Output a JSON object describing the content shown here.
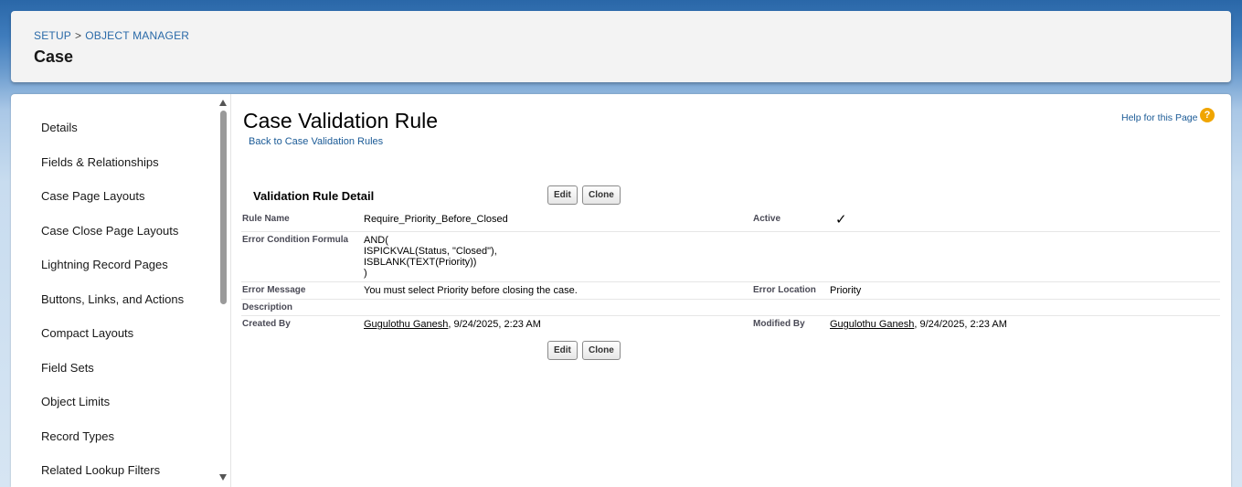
{
  "header": {
    "breadcrumb": [
      "SETUP",
      "OBJECT MANAGER"
    ],
    "breadcrumb_sep": ">",
    "title": "Case"
  },
  "sidebar": {
    "items": [
      {
        "label": "Details"
      },
      {
        "label": "Fields & Relationships"
      },
      {
        "label": "Case Page Layouts"
      },
      {
        "label": "Case Close Page Layouts"
      },
      {
        "label": "Lightning Record Pages"
      },
      {
        "label": "Buttons, Links, and Actions"
      },
      {
        "label": "Compact Layouts"
      },
      {
        "label": "Field Sets"
      },
      {
        "label": "Object Limits"
      },
      {
        "label": "Record Types"
      },
      {
        "label": "Related Lookup Filters"
      }
    ]
  },
  "main": {
    "page_title": "Case Validation Rule",
    "back_link": "Back to Case Validation Rules",
    "help_link": "Help for this Page",
    "help_icon": "?",
    "section_title": "Validation Rule Detail",
    "buttons": {
      "edit": "Edit",
      "clone": "Clone"
    },
    "fields": {
      "rule_name_label": "Rule Name",
      "rule_name": "Require_Priority_Before_Closed",
      "active_label": "Active",
      "active_icon": "checkmark-icon",
      "active_mark": "✓",
      "formula_label": "Error Condition Formula",
      "formula_lines": [
        "AND(",
        "ISPICKVAL(Status, \"Closed\"),",
        "ISBLANK(TEXT(Priority))",
        ")"
      ],
      "error_message_label": "Error Message",
      "error_message": "You must select Priority before closing the case.",
      "error_location_label": "Error Location",
      "error_location": "Priority",
      "description_label": "Description",
      "created_by_label": "Created By",
      "created_by_user": "Gugulothu Ganesh",
      "created_by_date": ", 9/24/2025, 2:23 AM",
      "modified_by_label": "Modified By",
      "modified_by_user": "Gugulothu Ganesh",
      "modified_by_date": ", 9/24/2025, 2:23 AM"
    }
  },
  "colors": {
    "link": "#1a5a96",
    "help_icon": "#f0a500"
  }
}
